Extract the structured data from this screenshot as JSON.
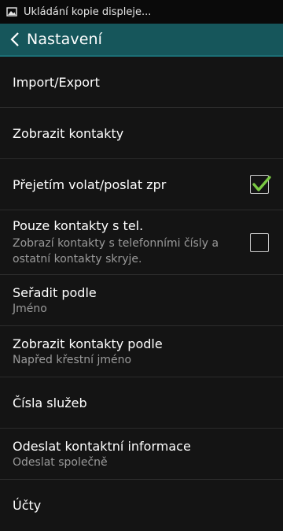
{
  "status_bar": {
    "text": "Ukládání kopie displeje...",
    "icon": "image-icon"
  },
  "action_bar": {
    "title": "Nastavení",
    "back_icon": "chevron-left-icon"
  },
  "settings": [
    {
      "label": "Import/Export",
      "sub": null
    },
    {
      "label": "Zobrazit kontakty",
      "sub": null
    },
    {
      "label": "Přejetím volat/poslat zpr",
      "sub": null,
      "checkbox": true,
      "checked": true
    },
    {
      "label": "Pouze kontakty s tel.",
      "sub": "Zobrazí kontakty s telefonními čísly a ostatní kontakty skryje.",
      "checkbox": true,
      "checked": false
    },
    {
      "label": "Seřadit podle",
      "sub": "Jméno"
    },
    {
      "label": "Zobrazit kontakty podle",
      "sub": "Napřed křestní jméno"
    },
    {
      "label": "Čísla služeb",
      "sub": null
    },
    {
      "label": "Odeslat kontaktní informace",
      "sub": "Odeslat společně"
    },
    {
      "label": "Účty",
      "sub": null
    }
  ],
  "colors": {
    "accent": "#16565b",
    "check_green": "#7ac943",
    "background": "#141414"
  }
}
